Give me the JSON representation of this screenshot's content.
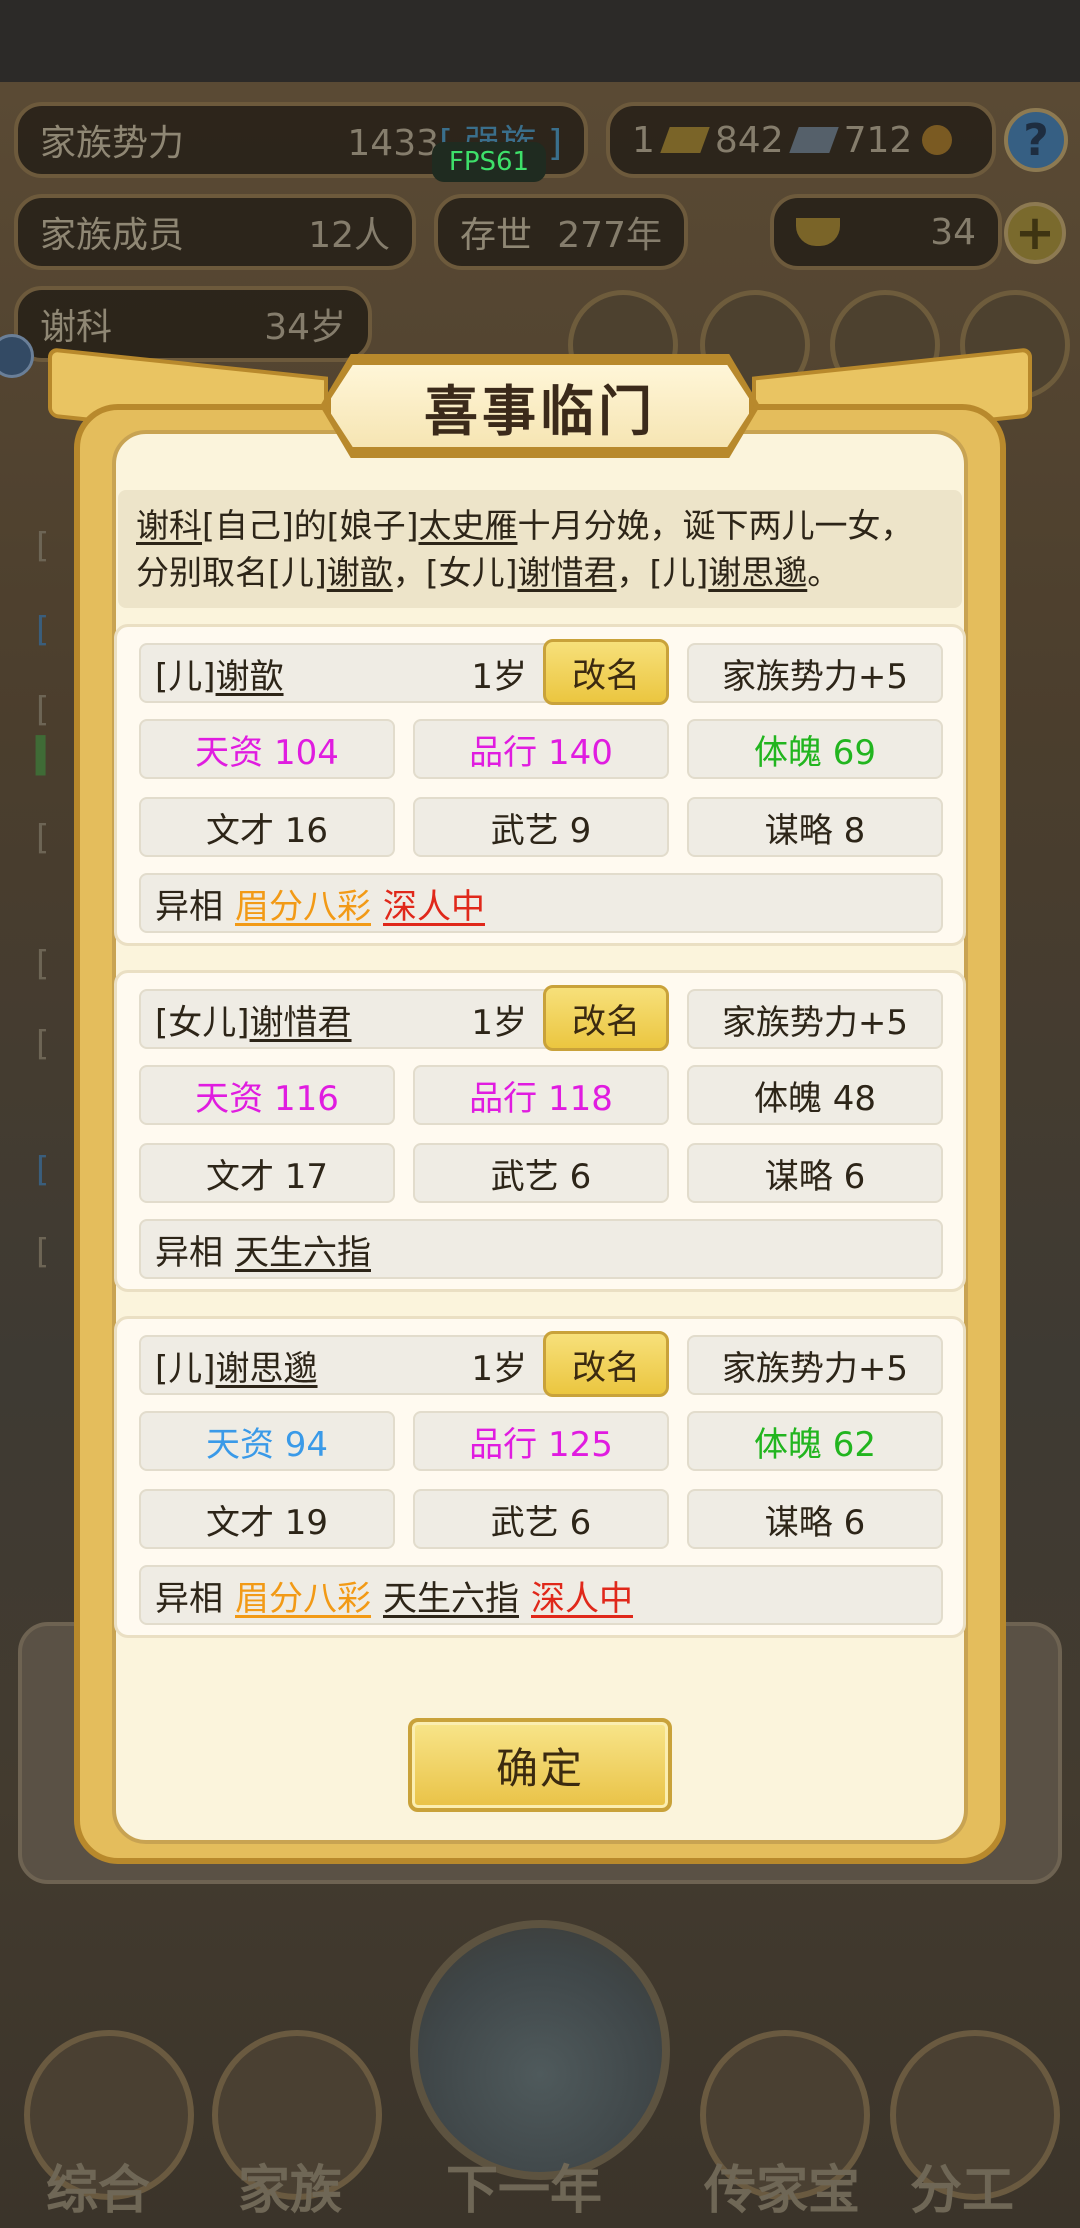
{
  "background": {
    "family_power_label": "家族势力",
    "family_power_value": "1433",
    "family_power_tag": "[ 强族 ]",
    "resource_1": "1",
    "resource_2": "842",
    "resource_3": "712",
    "family_members_label": "家族成员",
    "family_members_value": "12人",
    "existence_label": "存世",
    "existence_value": "277年",
    "gold_value": "34",
    "person_name": "谢科",
    "person_age": "34岁",
    "fps": "FPS61",
    "bottom_nav": [
      "综合",
      "家族",
      "下一年",
      "传家宝",
      "分工"
    ]
  },
  "dialog": {
    "title": "喜事临门",
    "message": {
      "line1_parts": [
        "谢科",
        "[自己]的[娘子]",
        "太史雁",
        "十月分娩，诞下两儿一女，"
      ],
      "line2_parts": [
        "分别取名[儿]",
        "谢歆",
        "，[女儿]",
        "谢惜君",
        "，[儿]",
        "谢思邈",
        "。"
      ]
    },
    "rename_label": "改名",
    "confirm_label": "确定",
    "children": [
      {
        "relation": "[儿]",
        "name": "谢歆",
        "age": "1岁",
        "family_power": "家族势力+5",
        "aptitude": "天资 104",
        "conduct": "品行 140",
        "physique": "体魄 69",
        "literary": "文才 16",
        "martial": "武艺 9",
        "strategy": "谋略 8",
        "traits_label": "异相",
        "traits": [
          "眉分八彩",
          "深人中"
        ]
      },
      {
        "relation": "[女儿]",
        "name": "谢惜君",
        "age": "1岁",
        "family_power": "家族势力+5",
        "aptitude": "天资 116",
        "conduct": "品行 118",
        "physique": "体魄 48",
        "literary": "文才 17",
        "martial": "武艺 6",
        "strategy": "谋略 6",
        "traits_label": "异相",
        "traits": [
          "天生六指"
        ]
      },
      {
        "relation": "[儿]",
        "name": "谢思邈",
        "age": "1岁",
        "family_power": "家族势力+5",
        "aptitude": "天资 94",
        "conduct": "品行 125",
        "physique": "体魄 62",
        "literary": "文才 19",
        "martial": "武艺 6",
        "strategy": "谋略 6",
        "traits_label": "异相",
        "traits": [
          "眉分八彩",
          "天生六指",
          "深人中"
        ]
      }
    ]
  },
  "colors": {
    "magenta": "#e01ce0",
    "green": "#22b51f",
    "blue": "#3a9ae8",
    "orange_trait": "#f29a16",
    "red_trait": "#e0281a",
    "gold_button": "#ebc640"
  }
}
